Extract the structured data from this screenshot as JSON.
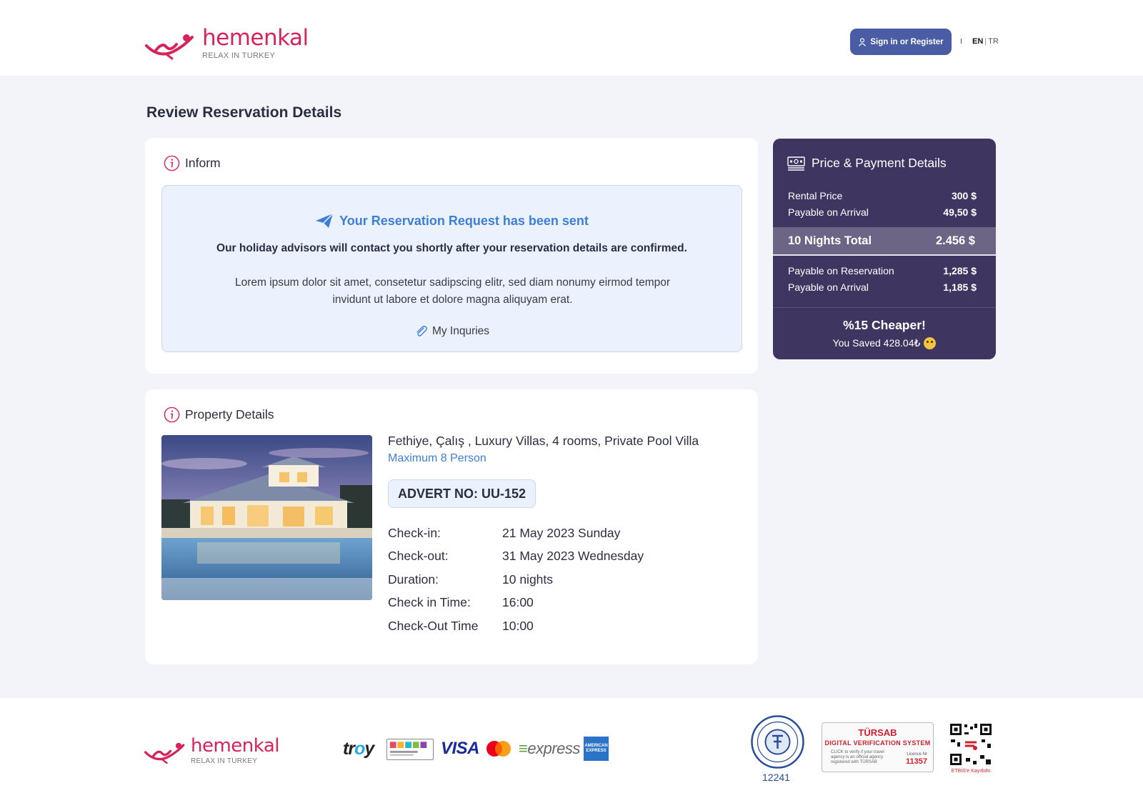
{
  "header": {
    "brand": "hemenkal",
    "tagline": "RELAX IN TURKEY",
    "signin_label": "Sign in or Register",
    "lang_active": "EN",
    "lang_sep": "|",
    "lang_other": "TR"
  },
  "page_title": "Review Reservation Details",
  "inform": {
    "heading": "Inform",
    "title": "Your Reservation Request has been sent",
    "strong_text": "Our holiday advisors will contact you shortly after your reservation details are confirmed.",
    "body_text": "Lorem ipsum dolor sit amet, consetetur sadipscing elitr, sed diam nonumy eirmod tempor invidunt ut labore et dolore magna aliquyam erat.",
    "inquiries_label": "My Inquries"
  },
  "property": {
    "heading": "Property Details",
    "name": "Fethiye, Çalış , Luxury Villas, 4 rooms, Private Pool Villa",
    "capacity": "Maximum 8 Person",
    "advert": "ADVERT NO: UU-152",
    "details": [
      {
        "key": "Check-in:",
        "value": "21 May 2023 Sunday"
      },
      {
        "key": "Check-out:",
        "value": "31 May 2023 Wednesday"
      },
      {
        "key": "Duration:",
        "value": "10 nights"
      },
      {
        "key": "Check in Time:",
        "value": "16:00"
      },
      {
        "key": "Check-Out Time",
        "value": "10:00"
      }
    ]
  },
  "price": {
    "heading": "Price & Payment Details",
    "rows_top": [
      {
        "label": "Rental Price",
        "value": "300 $"
      },
      {
        "label": "Payable on Arrival",
        "value": "49,50 $"
      }
    ],
    "total_label": "10 Nights Total",
    "total_value": "2.456 $",
    "rows_bottom": [
      {
        "label": "Payable on Reservation",
        "value": "1,285 $"
      },
      {
        "label": "Payable on Arrival",
        "value": "1,185 $"
      }
    ],
    "cheaper": "%15 Cheaper!",
    "saved": "You Saved 428.04₺"
  },
  "footer": {
    "brand": "hemenkal",
    "tagline": "RELAX IN TURKEY",
    "payments": {
      "troy_a": "tr",
      "troy_b": "o",
      "troy_c": "y",
      "visa": "VISA",
      "express": "express",
      "amex_a": "AMERICAN",
      "amex_b": "EXPRESS"
    },
    "tso_number": "12241",
    "tursab": {
      "title": "TÜRSAB",
      "subtitle": "DIGITAL VERIFICATION SYSTEM",
      "desc": "CLICK to verify if your travel agency is an official agency registered with TÜRSAB",
      "licence_label": "Licence Nr",
      "licence_no": "11357"
    },
    "etbis": "ETBİS'e Kayıtlıdır."
  },
  "colors": {
    "brand": "#d6245a",
    "primary_button": "#4a5ca3",
    "accent_blue": "#3d7fd6",
    "price_panel": "#3f3561",
    "total_band": "#6d6585"
  }
}
